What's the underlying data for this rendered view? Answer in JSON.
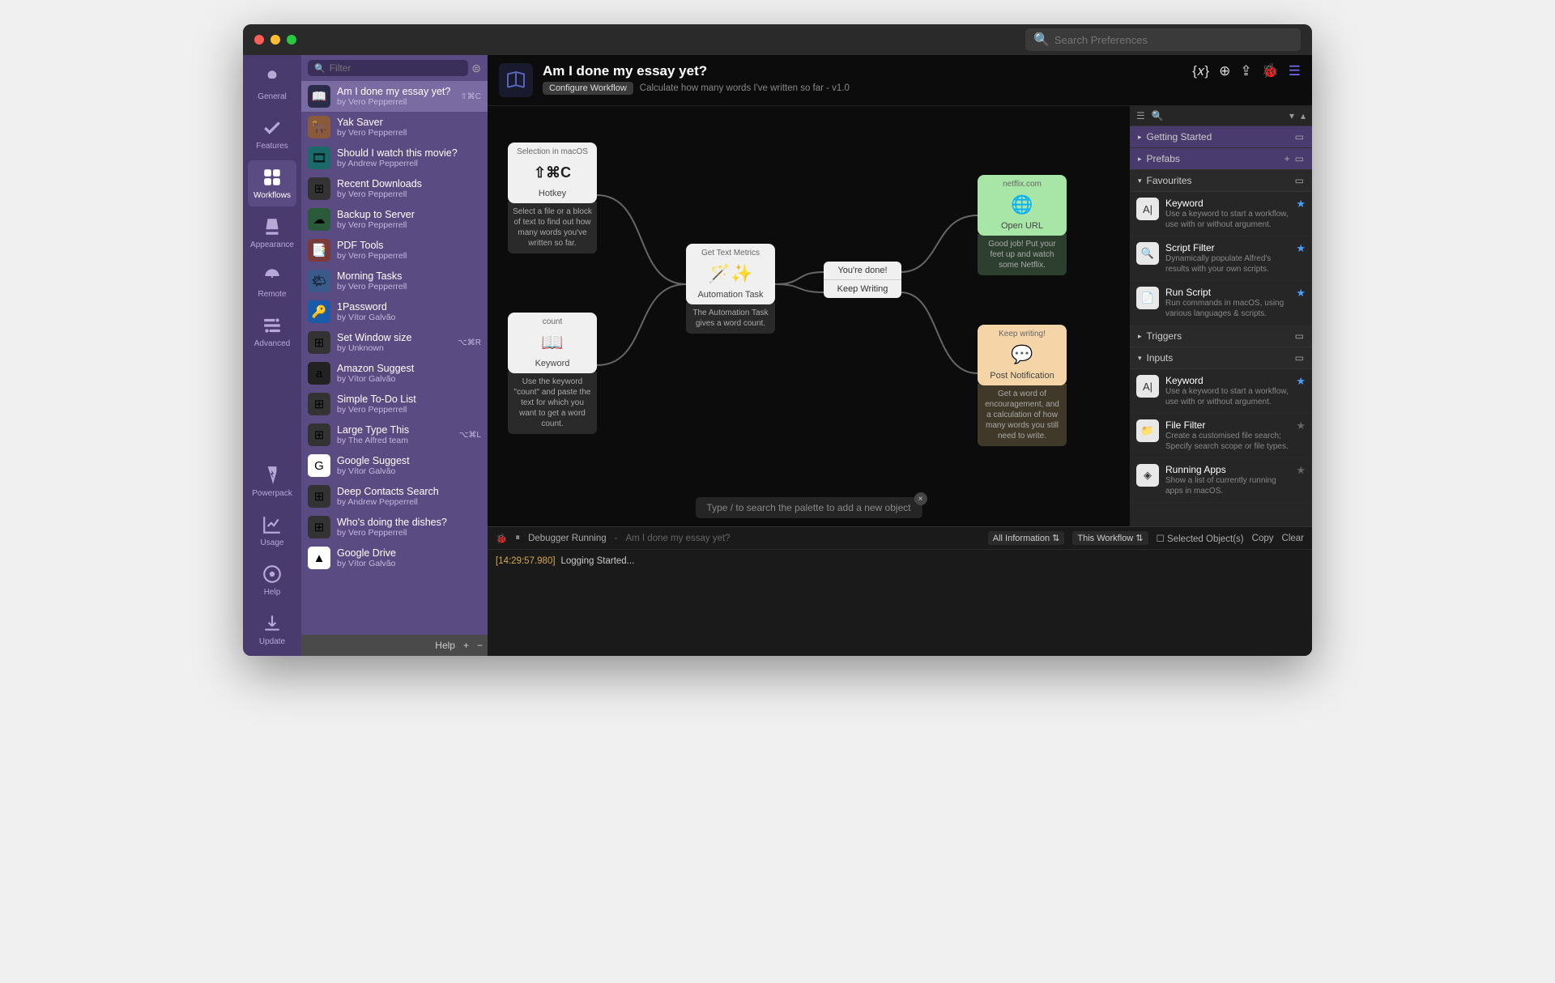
{
  "search_placeholder": "Search Preferences",
  "filter_placeholder": "Filter",
  "tabs": [
    {
      "id": "general",
      "label": "General"
    },
    {
      "id": "features",
      "label": "Features"
    },
    {
      "id": "workflows",
      "label": "Workflows"
    },
    {
      "id": "appearance",
      "label": "Appearance"
    },
    {
      "id": "remote",
      "label": "Remote"
    },
    {
      "id": "advanced",
      "label": "Advanced"
    }
  ],
  "bottom_tabs": [
    {
      "id": "powerpack",
      "label": "Powerpack"
    },
    {
      "id": "usage",
      "label": "Usage"
    },
    {
      "id": "help",
      "label": "Help"
    },
    {
      "id": "update",
      "label": "Update"
    }
  ],
  "workflows": [
    {
      "title": "Am I done my essay yet?",
      "author": "by Vero Pepperrell",
      "shortcut": "⇧⌘C",
      "icon": "📖",
      "selected": true,
      "iconbg": "#2b2b4a"
    },
    {
      "title": "Yak Saver",
      "author": "by Vero Pepperrell",
      "icon": "🐂",
      "iconbg": "#8a5a3a"
    },
    {
      "title": "Should I watch this movie?",
      "author": "by Andrew Pepperrell",
      "icon": "🎞",
      "iconbg": "#1a6a6a"
    },
    {
      "title": "Recent Downloads",
      "author": "by Vero Pepperrell",
      "icon": "⊞",
      "iconbg": "#333"
    },
    {
      "title": "Backup to Server",
      "author": "by Vero Pepperrell",
      "icon": "☁",
      "iconbg": "#2a5a3a"
    },
    {
      "title": "PDF Tools",
      "author": "by Vero Pepperrell",
      "icon": "📑",
      "iconbg": "#7a3a3a"
    },
    {
      "title": "Morning Tasks",
      "author": "by Vero Pepperrell",
      "icon": "🌤",
      "iconbg": "#3a5a8a"
    },
    {
      "title": "1Password",
      "author": "by Vítor Galvão",
      "icon": "🔑",
      "iconbg": "#1a5aaa"
    },
    {
      "title": "Set Window size",
      "author": "by Unknown",
      "shortcut": "⌥⌘R",
      "icon": "⊞",
      "iconbg": "#333"
    },
    {
      "title": "Amazon Suggest",
      "author": "by Vítor Galvão",
      "icon": "a",
      "iconbg": "#222"
    },
    {
      "title": "Simple To-Do List",
      "author": "by Vero Pepperrell",
      "icon": "⊞",
      "iconbg": "#333"
    },
    {
      "title": "Large Type This",
      "author": "by The Alfred team",
      "shortcut": "⌥⌘L",
      "icon": "⊞",
      "iconbg": "#333"
    },
    {
      "title": "Google Suggest",
      "author": "by Vítor Galvão",
      "icon": "G",
      "iconbg": "#fff"
    },
    {
      "title": "Deep Contacts Search",
      "author": "by Andrew Pepperrell",
      "icon": "⊞",
      "iconbg": "#333"
    },
    {
      "title": "Who's doing the dishes?",
      "author": "by Vero Pepperrell",
      "icon": "⊞",
      "iconbg": "#333"
    },
    {
      "title": "Google Drive",
      "author": "by Vítor Galvão",
      "icon": "▲",
      "iconbg": "#fff"
    }
  ],
  "wf_footer": {
    "help": "Help",
    "plus": "+",
    "minus": "−"
  },
  "header": {
    "title": "Am I done my essay yet?",
    "configure": "Configure Workflow",
    "desc": "Calculate how many words I've written so far - v1.0"
  },
  "nodes": {
    "hotkey": {
      "top": "Selection in macOS",
      "mid": "⇧⌘C",
      "bot": "Hotkey",
      "desc": "Select a file or a block of text to find out how many words you've written so far."
    },
    "keyword": {
      "top": "count",
      "bot": "Keyword",
      "desc": "Use the keyword \"count\" and paste the text for which you want to get a word count."
    },
    "task": {
      "top": "Get Text Metrics",
      "bot": "Automation Task",
      "desc": "The Automation Task gives a word count."
    },
    "cond": {
      "a": "You're done!",
      "b": "Keep Writing"
    },
    "url": {
      "top": "netflix.com",
      "bot": "Open URL",
      "desc": "Good job! Put your feet up and watch some Netflix."
    },
    "notif": {
      "top": "Keep writing!",
      "bot": "Post Notification",
      "desc": "Get a word of encouragement, and a calculation of how many words you still need to write."
    }
  },
  "palette_hint": "Type / to search the palette to add a new object",
  "inspector": {
    "sections": [
      {
        "title": "Getting Started",
        "open": false,
        "bg": "purple"
      },
      {
        "title": "Prefabs",
        "open": false,
        "bg": "purple",
        "plus": true
      },
      {
        "title": "Favourites",
        "open": true,
        "bg": "dark",
        "items": [
          {
            "title": "Keyword",
            "desc": "Use a keyword to start a workflow, use with or without argument.",
            "star": true,
            "icon": "A|"
          },
          {
            "title": "Script Filter",
            "desc": "Dynamically populate Alfred's results with your own scripts.",
            "star": true,
            "icon": "🔍"
          },
          {
            "title": "Run Script",
            "desc": "Run commands in macOS, using various languages & scripts.",
            "star": true,
            "icon": "📄"
          }
        ]
      },
      {
        "title": "Triggers",
        "open": false,
        "bg": "dark"
      },
      {
        "title": "Inputs",
        "open": true,
        "bg": "dark",
        "items": [
          {
            "title": "Keyword",
            "desc": "Use a keyword to start a workflow, use with or without argument.",
            "star": true,
            "icon": "A|"
          },
          {
            "title": "File Filter",
            "desc": "Create a customised file search; Specify search scope or file types.",
            "star": false,
            "icon": "📁"
          },
          {
            "title": "Running Apps",
            "desc": "Show a list of currently running apps in macOS.",
            "star": false,
            "icon": "◈"
          }
        ]
      }
    ]
  },
  "debugger": {
    "status": "Debugger Running",
    "ctx": "Am I done my essay yet?",
    "filter1": "All Information",
    "filter2": "This Workflow",
    "sel": "Selected Object(s)",
    "copy": "Copy",
    "clear": "Clear",
    "ts": "[14:29:57.980]",
    "msg": "Logging Started..."
  }
}
